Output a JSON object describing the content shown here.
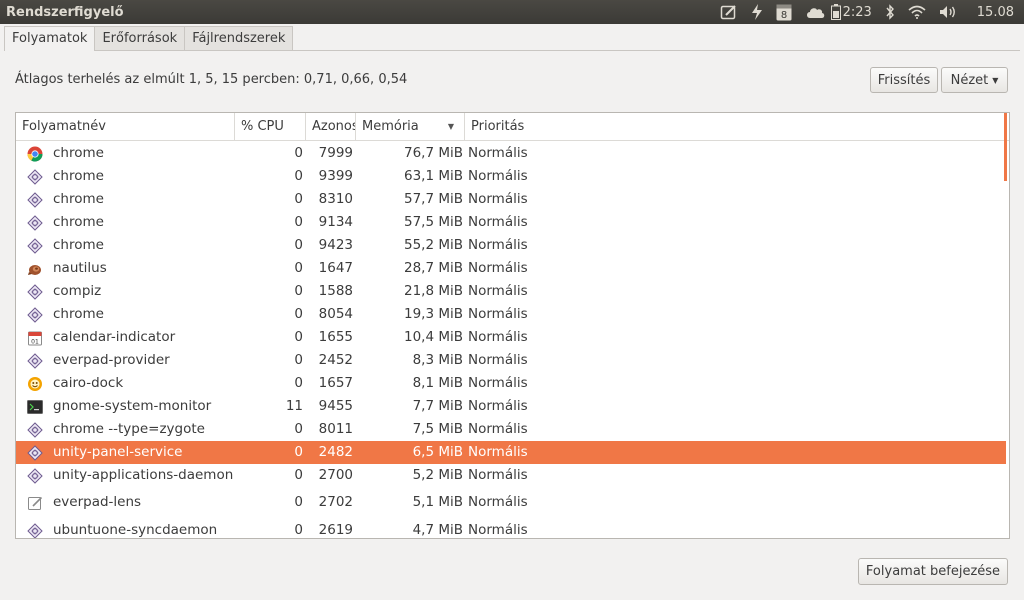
{
  "window": {
    "title": "Rendszerfigyelő"
  },
  "tray": {
    "items": [
      {
        "icon": "notes-icon"
      },
      {
        "icon": "power-icon"
      },
      {
        "icon": "calendar-icon",
        "text": "8"
      },
      {
        "icon": "cloud-icon"
      },
      {
        "icon": "battery-icon",
        "text": "2:23"
      },
      {
        "icon": "bluetooth-icon"
      },
      {
        "icon": "wifi-icon"
      },
      {
        "icon": "volume-icon"
      },
      {
        "text": "15.08"
      }
    ]
  },
  "tabs": [
    {
      "label": "Folyamatok",
      "active": true
    },
    {
      "label": "Erőforrások",
      "active": false
    },
    {
      "label": "Fájlrendszerek",
      "active": false
    }
  ],
  "load_average": "Átlagos terhelés az elmúlt 1, 5, 15 percben: 0,71, 0,66, 0,54",
  "buttons": {
    "refresh": "Frissítés",
    "view": "Nézet",
    "end_process": "Folyamat befejezése"
  },
  "table": {
    "columns": [
      "Folyamatnév",
      "% CPU",
      "Azonosító",
      "Memória",
      "Prioritás"
    ],
    "rows": [
      {
        "icon": "chrome-icon",
        "name": "chrome",
        "cpu": "0",
        "pid": "7999",
        "mem": "76,7 MiB",
        "prio": "Normális"
      },
      {
        "icon": "gear-diamond-icon",
        "name": "chrome",
        "cpu": "0",
        "pid": "9399",
        "mem": "63,1 MiB",
        "prio": "Normális"
      },
      {
        "icon": "gear-diamond-icon",
        "name": "chrome",
        "cpu": "0",
        "pid": "8310",
        "mem": "57,7 MiB",
        "prio": "Normális"
      },
      {
        "icon": "gear-diamond-icon",
        "name": "chrome",
        "cpu": "0",
        "pid": "9134",
        "mem": "57,5 MiB",
        "prio": "Normális"
      },
      {
        "icon": "gear-diamond-icon",
        "name": "chrome",
        "cpu": "0",
        "pid": "9423",
        "mem": "55,2 MiB",
        "prio": "Normális"
      },
      {
        "icon": "nautilus-icon",
        "name": "nautilus",
        "cpu": "0",
        "pid": "1647",
        "mem": "28,7 MiB",
        "prio": "Normális"
      },
      {
        "icon": "gear-diamond-icon",
        "name": "compiz",
        "cpu": "0",
        "pid": "1588",
        "mem": "21,8 MiB",
        "prio": "Normális"
      },
      {
        "icon": "gear-diamond-icon",
        "name": "chrome",
        "cpu": "0",
        "pid": "8054",
        "mem": "19,3 MiB",
        "prio": "Normális"
      },
      {
        "icon": "calendar-app-icon",
        "name": "calendar-indicator",
        "cpu": "0",
        "pid": "1655",
        "mem": "10,4 MiB",
        "prio": "Normális"
      },
      {
        "icon": "gear-diamond-icon",
        "name": "everpad-provider",
        "cpu": "0",
        "pid": "2452",
        "mem": "8,3 MiB",
        "prio": "Normális"
      },
      {
        "icon": "cairo-dock-icon",
        "name": "cairo-dock",
        "cpu": "0",
        "pid": "1657",
        "mem": "8,1 MiB",
        "prio": "Normális"
      },
      {
        "icon": "terminal-icon",
        "name": "gnome-system-monitor",
        "cpu": "11",
        "pid": "9455",
        "mem": "7,7 MiB",
        "prio": "Normális"
      },
      {
        "icon": "gear-diamond-icon",
        "name": "chrome --type=zygote",
        "cpu": "0",
        "pid": "8011",
        "mem": "7,5 MiB",
        "prio": "Normális"
      },
      {
        "icon": "gear-diamond-icon",
        "name": "unity-panel-service",
        "cpu": "0",
        "pid": "2482",
        "mem": "6,5 MiB",
        "prio": "Normális",
        "selected": true
      },
      {
        "icon": "gear-diamond-icon",
        "name": "unity-applications-daemon",
        "cpu": "0",
        "pid": "2700",
        "mem": "5,2 MiB",
        "prio": "Normális"
      },
      {
        "icon": "pencil-note-icon",
        "name": "everpad-lens",
        "cpu": "0",
        "pid": "2702",
        "mem": "5,1 MiB",
        "prio": "Normális"
      },
      {
        "icon": "gear-diamond-icon",
        "name": "ubuntuone-syncdaemon",
        "cpu": "0",
        "pid": "2619",
        "mem": "4,7 MiB",
        "prio": "Normális"
      }
    ]
  },
  "colors": {
    "selection": "#f07746",
    "panel": "#3c3b37"
  }
}
